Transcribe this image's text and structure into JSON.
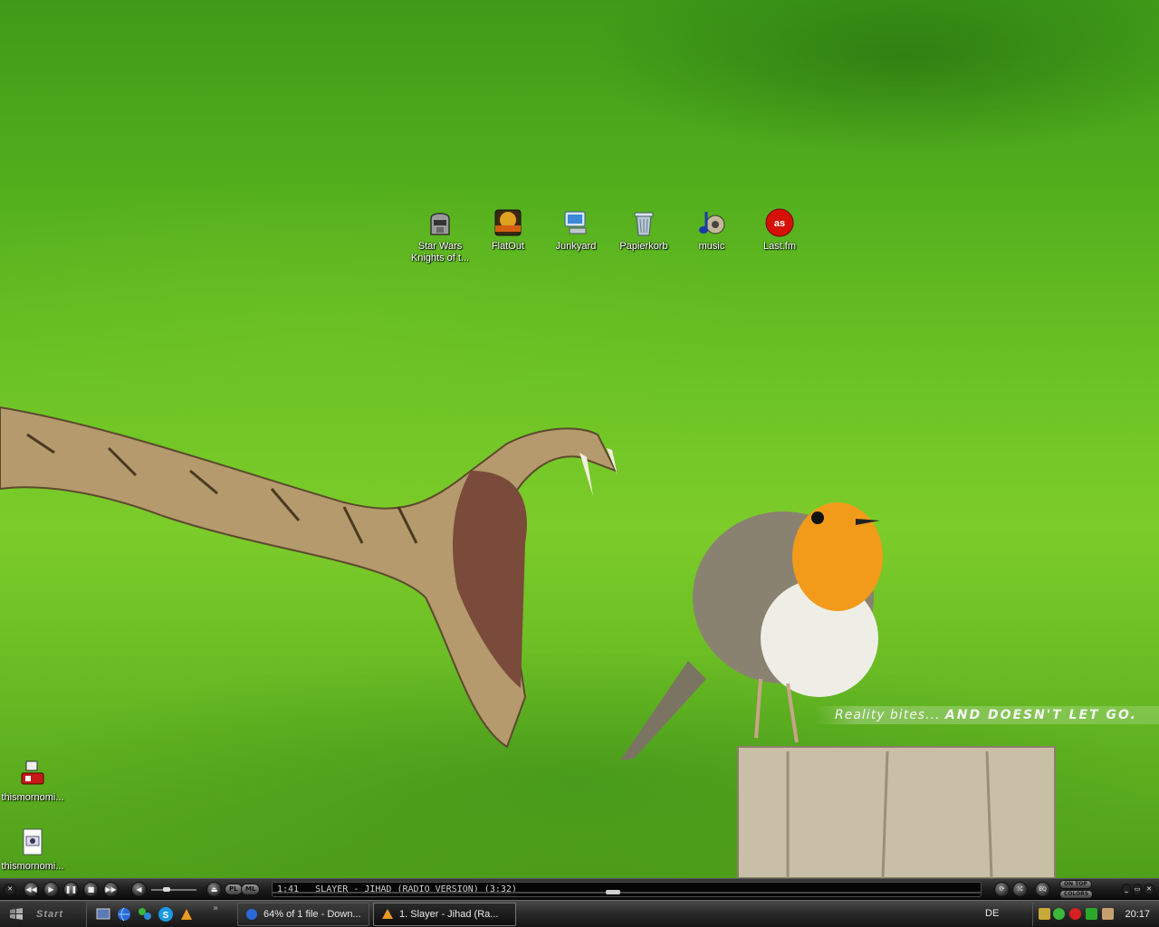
{
  "desktop": {
    "top_icons": [
      {
        "label": "Star Wars Knights of t...",
        "icon": "game-helmet-icon"
      },
      {
        "label": "FlatOut",
        "icon": "flatout-game-icon"
      },
      {
        "label": "Junkyard",
        "icon": "computer-icon"
      },
      {
        "label": "Papierkorb",
        "icon": "recycle-bin-icon"
      },
      {
        "label": "music",
        "icon": "music-note-icon"
      },
      {
        "label": "Last.fm",
        "icon": "lastfm-icon"
      }
    ],
    "left_icons": [
      {
        "label": "thismornomi...",
        "icon": "installer-icon"
      },
      {
        "label": "thismornomi...",
        "icon": "document-icon"
      }
    ],
    "slogan": {
      "light": "Reality bites...",
      "bold": "AND DOESN'T LET GO."
    }
  },
  "winamp": {
    "time": "1:41",
    "title": "SLAYER - JIHAD (RADIO VERSION) (3:32)",
    "progress": 0.48,
    "volume": 0.3,
    "btn_pl": "PL",
    "btn_ml": "ML",
    "btn_eq": "EQ",
    "on_top": "ON TOP",
    "colors": "COLORS"
  },
  "taskbar": {
    "start_label": "Start",
    "tasks": [
      {
        "label": "64% of 1 file - Down...",
        "icon": "download-globe-icon"
      },
      {
        "label": "1. Slayer - Jihad (Ra...",
        "icon": "winamp-icon"
      }
    ],
    "language": "DE",
    "clock": "20:17"
  },
  "colors": {
    "desktop_green": "#5fb81e",
    "taskbar_dark": "#1c1c1c"
  }
}
